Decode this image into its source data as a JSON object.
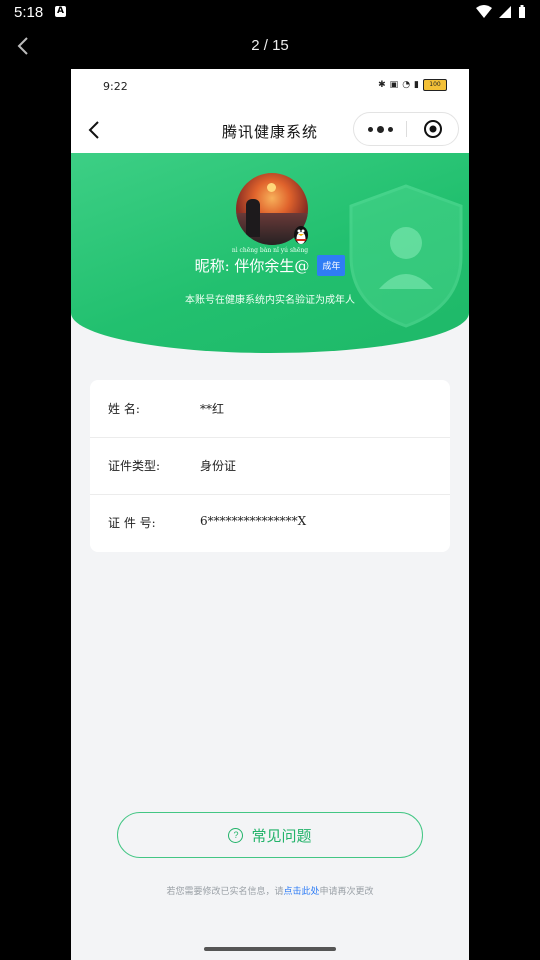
{
  "status_bar": {
    "time": "5:18",
    "notification_badge": "A"
  },
  "viewer": {
    "counter": "2 / 15"
  },
  "phone": {
    "status_time": "9:22",
    "battery": "100",
    "nav_title": "腾讯健康系统",
    "banner": {
      "nickname_pinyin": "nì chēng bàn nǐ yú shēng",
      "nickname": "昵称: 伴你余生@",
      "tag": "成年",
      "note": "本账号在健康系统内实名验证为成年人"
    },
    "info": {
      "rows": [
        {
          "label": "姓      名:",
          "value": "**红"
        },
        {
          "label": "证件类型:",
          "value": "身份证"
        },
        {
          "label": "证  件  号:",
          "value": "6***************X"
        }
      ]
    },
    "faq_button": "常见问题",
    "footer": {
      "prefix": "若您需要修改已实名信息，请",
      "link": "点击此处",
      "suffix": "申请再次更改"
    }
  }
}
